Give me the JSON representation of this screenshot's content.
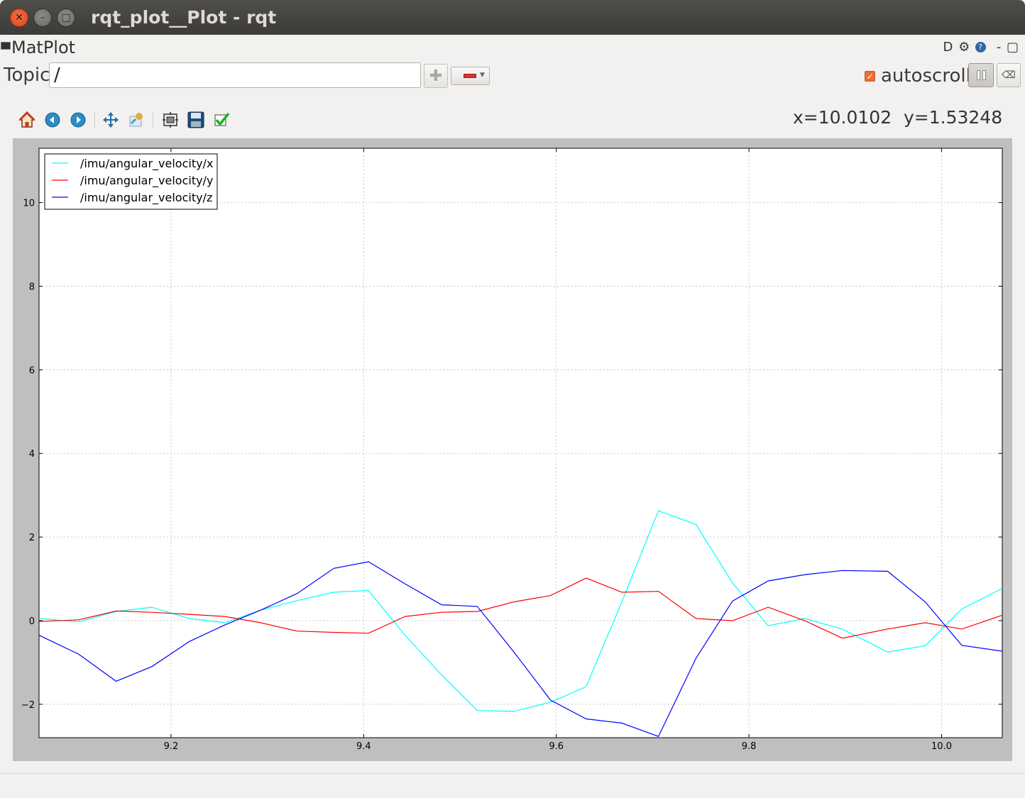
{
  "window": {
    "title": "rqt_plot__Plot - rqt"
  },
  "plugin": {
    "title": "MatPlot",
    "tools": [
      "D",
      "gear-icon",
      "help-icon",
      "-",
      "close-icon"
    ]
  },
  "topic": {
    "label": "Topic",
    "value": "/"
  },
  "autoscroll": {
    "label": "autoscroll",
    "checked": true
  },
  "toolbar": {
    "items": [
      "home-icon",
      "back-icon",
      "forward-icon",
      "pan-icon",
      "zoom-icon",
      "subplots-icon",
      "save-icon",
      "edit-curves-icon"
    ]
  },
  "coords": {
    "x": "x=10.0102",
    "y": "y=1.53248"
  },
  "chart_data": {
    "type": "line",
    "title": "",
    "xlabel": "",
    "ylabel": "",
    "xlim": [
      9.063,
      10.063
    ],
    "ylim": [
      -2.8,
      11.3
    ],
    "xticks": [
      9.2,
      9.4,
      9.6,
      9.8,
      10.0
    ],
    "xtick_labels": [
      "9.2",
      "9.4",
      "9.6",
      "9.8",
      "10.0"
    ],
    "yticks": [
      -2,
      0,
      2,
      4,
      6,
      8,
      10
    ],
    "ytick_labels": [
      "−2",
      "0",
      "2",
      "4",
      "6",
      "8",
      "10"
    ],
    "grid": true,
    "legend_position": "top-left",
    "series": [
      {
        "name": "/imu/angular_velocity/x",
        "color": "#00ffff",
        "x": [
          9.063,
          9.104,
          9.143,
          9.18,
          9.219,
          9.256,
          9.293,
          9.331,
          9.369,
          9.405,
          9.443,
          9.481,
          9.518,
          9.556,
          9.594,
          9.631,
          9.668,
          9.706,
          9.745,
          9.783,
          9.82,
          9.858,
          9.897,
          9.944,
          9.983,
          10.021,
          10.063
        ],
        "y": [
          0.05,
          -0.03,
          0.22,
          0.32,
          0.05,
          -0.05,
          0.25,
          0.48,
          0.68,
          0.72,
          -0.35,
          -1.3,
          -2.15,
          -2.17,
          -1.95,
          -1.58,
          0.45,
          2.63,
          2.3,
          0.9,
          -0.12,
          0.05,
          -0.2,
          -0.75,
          -0.6,
          0.28,
          0.77
        ]
      },
      {
        "name": "/imu/angular_velocity/y",
        "color": "#ff0000",
        "x": [
          9.063,
          9.104,
          9.143,
          9.18,
          9.219,
          9.256,
          9.293,
          9.331,
          9.369,
          9.405,
          9.443,
          9.481,
          9.518,
          9.556,
          9.594,
          9.631,
          9.668,
          9.706,
          9.745,
          9.783,
          9.82,
          9.858,
          9.897,
          9.944,
          9.983,
          10.021,
          10.063
        ],
        "y": [
          -0.02,
          0.02,
          0.23,
          0.2,
          0.15,
          0.1,
          -0.05,
          -0.25,
          -0.28,
          -0.3,
          0.1,
          0.2,
          0.22,
          0.45,
          0.6,
          1.02,
          0.68,
          0.7,
          0.05,
          0.0,
          0.32,
          0.0,
          -0.42,
          -0.2,
          -0.05,
          -0.2,
          0.13
        ]
      },
      {
        "name": "/imu/angular_velocity/z",
        "color": "#0000ff",
        "x": [
          9.063,
          9.104,
          9.143,
          9.18,
          9.219,
          9.256,
          9.293,
          9.331,
          9.369,
          9.405,
          9.443,
          9.481,
          9.518,
          9.556,
          9.594,
          9.631,
          9.668,
          9.706,
          9.745,
          9.783,
          9.82,
          9.858,
          9.897,
          9.944,
          9.983,
          10.021,
          10.063
        ],
        "y": [
          -0.35,
          -0.8,
          -1.45,
          -1.1,
          -0.5,
          -0.1,
          0.25,
          0.65,
          1.25,
          1.41,
          0.88,
          0.38,
          0.34,
          -0.75,
          -1.9,
          -2.35,
          -2.45,
          -2.77,
          -0.9,
          0.47,
          0.95,
          1.1,
          1.2,
          1.18,
          0.45,
          -0.59,
          -0.73
        ]
      }
    ]
  }
}
